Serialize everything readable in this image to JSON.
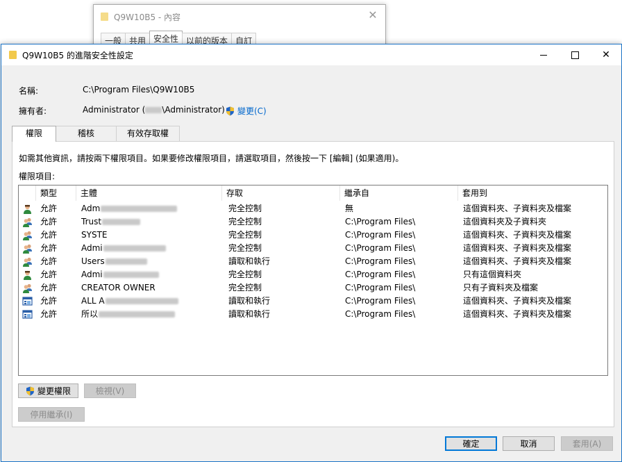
{
  "background_dialog": {
    "title": "Q9W10B5 - 內容",
    "tabs": [
      "一般",
      "共用",
      "安全性",
      "以前的版本",
      "自訂"
    ],
    "active_tab": 2
  },
  "dialog": {
    "title": "Q9W10B5 的進階安全性設定",
    "name_label": "名稱:",
    "name_value": "C:\\Program Files\\Q9W10B5",
    "owner_label": "擁有者:",
    "owner_prefix": "Administrator (",
    "owner_suffix": "\\Administrator)",
    "change_link": "變更(C)",
    "tabs": [
      "權限",
      "稽核",
      "有效存取權"
    ],
    "info_text": "如需其他資訊，請按兩下權限項目。如果要修改權限項目，請選取項目，然後按一下 [編輯] (如果適用)。",
    "list_label": "權限項目:",
    "columns": [
      "類型",
      "主體",
      "存取",
      "繼承自",
      "套用到"
    ],
    "rows": [
      {
        "icon": "user-icon",
        "type": "允許",
        "principal": "Adm",
        "access": "完全控制",
        "inherited": "無",
        "applies": "這個資料夾、子資料夾及檔案"
      },
      {
        "icon": "group-icon",
        "type": "允許",
        "principal": "Trust",
        "access": "完全控制",
        "inherited": "C:\\Program Files\\",
        "applies": "這個資料夾及子資料夾"
      },
      {
        "icon": "group-icon",
        "type": "允許",
        "principal": "SYSTE",
        "access": "完全控制",
        "inherited": "C:\\Program Files\\",
        "applies": "這個資料夾、子資料夾及檔案"
      },
      {
        "icon": "group-icon",
        "type": "允許",
        "principal": "Admi",
        "access": "完全控制",
        "inherited": "C:\\Program Files\\",
        "applies": "這個資料夾、子資料夾及檔案"
      },
      {
        "icon": "group-icon",
        "type": "允許",
        "principal": "Users",
        "access": "讀取和執行",
        "inherited": "C:\\Program Files\\",
        "applies": "這個資料夾、子資料夾及檔案"
      },
      {
        "icon": "user-icon",
        "type": "允許",
        "principal": "Admi",
        "access": "完全控制",
        "inherited": "C:\\Program Files\\",
        "applies": "只有這個資料夾"
      },
      {
        "icon": "group-icon",
        "type": "允許",
        "principal": "CREATOR OWNER",
        "access": "完全控制",
        "inherited": "C:\\Program Files\\",
        "applies": "只有子資料夾及檔案"
      },
      {
        "icon": "package-icon",
        "type": "允許",
        "principal": "ALL A",
        "access": "讀取和執行",
        "inherited": "C:\\Program Files\\",
        "applies": "這個資料夾、子資料夾及檔案"
      },
      {
        "icon": "package-icon",
        "type": "允許",
        "principal": "所以",
        "access": "讀取和執行",
        "inherited": "C:\\Program Files\\",
        "applies": "這個資料夾、子資料夾及檔案"
      }
    ],
    "buttons": {
      "change_perm": "變更權限",
      "view": "檢視(V)",
      "disable_inherit": "停用繼承(I)",
      "ok": "確定",
      "cancel": "取消",
      "apply": "套用(A)"
    }
  }
}
